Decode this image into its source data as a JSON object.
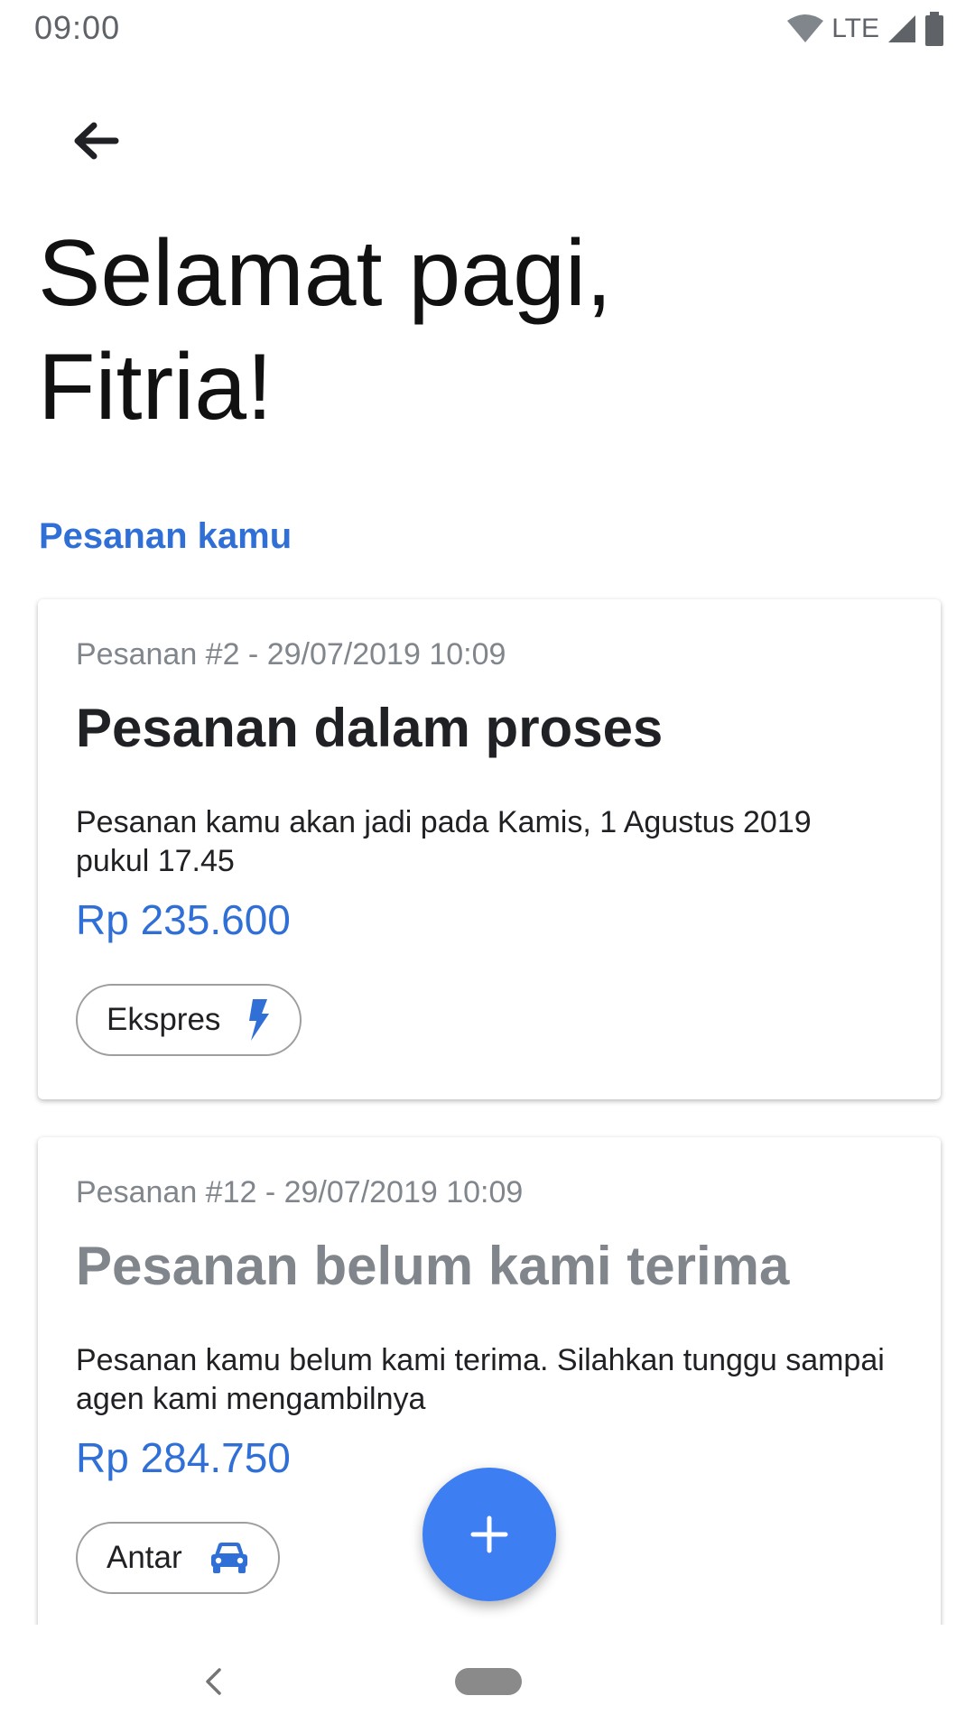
{
  "status_bar": {
    "time": "09:00",
    "network": "LTE",
    "icons": [
      "wifi-icon",
      "cell-signal-icon",
      "battery-icon"
    ]
  },
  "header": {
    "back_icon": "arrow-back-icon",
    "greeting_line1": "Selamat pagi,",
    "greeting_line2": "Fitria!"
  },
  "section": {
    "title": "Pesanan kamu"
  },
  "orders": [
    {
      "meta": "Pesanan #2 - 29/07/2019 10:09",
      "status": "Pesanan dalam proses",
      "description": "Pesanan kamu akan jadi pada Kamis, 1 Agustus 2019 pukul 17.45",
      "price": "Rp 235.600",
      "chip_label": "Ekspres",
      "chip_icon": "lightning-bolt-icon"
    },
    {
      "meta": "Pesanan #12 - 29/07/2019 10:09",
      "status": "Pesanan belum kami terima",
      "description": "Pesanan kamu belum kami terima. Silahkan tunggu sampai agen kami mengambilnya",
      "price": "Rp 284.750",
      "chip_label": "Antar",
      "chip_icon": "car-icon"
    }
  ],
  "fab": {
    "icon": "plus-icon"
  },
  "nav_bar": {
    "icons": [
      "nav-back-icon",
      "nav-home-pill"
    ]
  },
  "colors": {
    "accent": "#2f6fd6",
    "fab": "#3d7ef2",
    "muted_text": "#80868b",
    "chip_border": "#9e9e9e"
  }
}
